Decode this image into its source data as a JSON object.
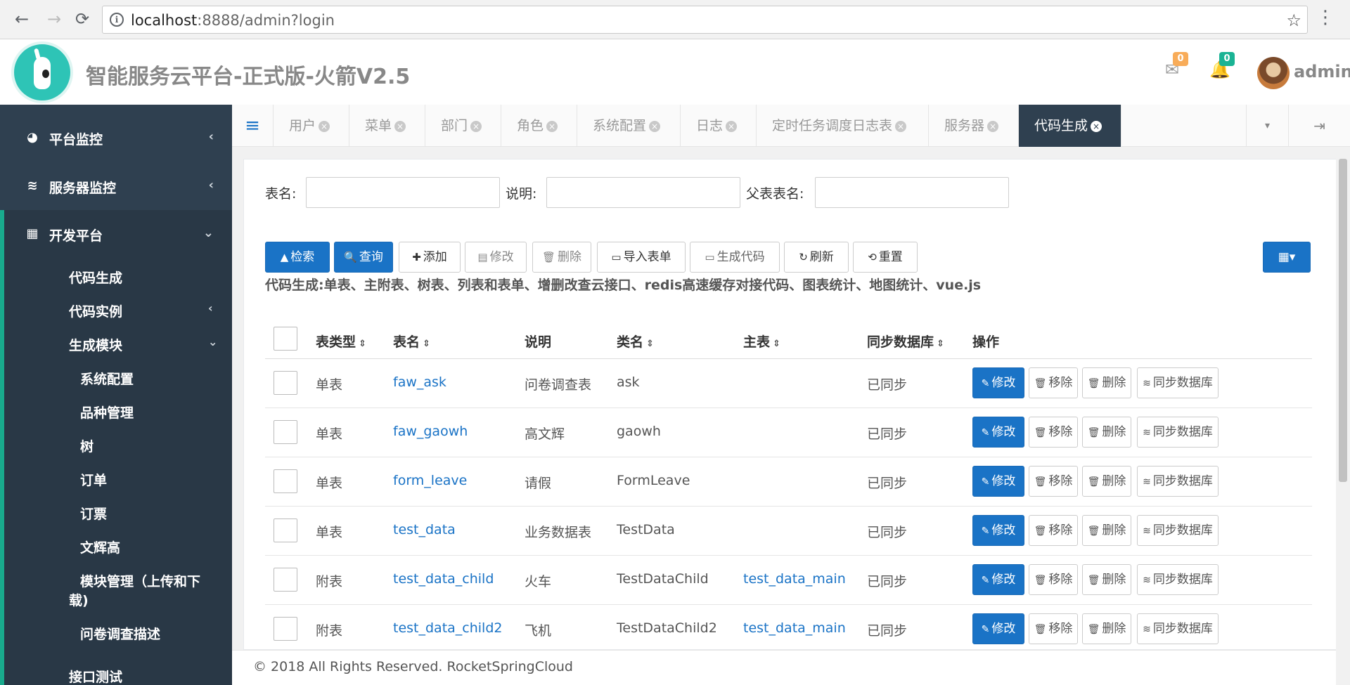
{
  "browser": {
    "url_host": "localhost",
    "url_rest": ":8888/admin?login",
    "back": "←",
    "forward": "→",
    "reload": "⟳",
    "info": "i",
    "star": "☆",
    "menu": "⋮"
  },
  "header": {
    "title": "智能服务云平台-正式版-火箭V2.5",
    "mail_count": "0",
    "bell_count": "0",
    "user": "admin",
    "mail_badge_color": "#f8ac59",
    "bell_badge_color": "#1ab394"
  },
  "sidebar": {
    "items": [
      {
        "label": "平台监控",
        "icon": "dashboard-icon",
        "glyph": "◕",
        "chev": "‹"
      },
      {
        "label": "服务器监控",
        "icon": "database-icon",
        "glyph": "≋",
        "chev": "‹"
      },
      {
        "label": "开发平台",
        "icon": "grid-icon",
        "glyph": "▦",
        "chev": "⌄"
      }
    ],
    "sub_items": [
      {
        "label": "代码生成"
      },
      {
        "label": "代码实例",
        "chev": "‹"
      },
      {
        "label": "生成模块",
        "chev": "⌄"
      }
    ],
    "module_items": [
      "系统配置",
      "品种管理",
      "树",
      "订单",
      "订票",
      "文辉高",
      "模块管理（上传和下",
      "载)",
      "问卷调查描述"
    ],
    "after_items": [
      "接口测试"
    ],
    "accent": "#19aa8d"
  },
  "tabs": {
    "toggle": "≡",
    "items": [
      "用户",
      "菜单",
      "部门",
      "角色",
      "系统配置",
      "日志",
      "定时任务调度日志表",
      "服务器",
      "代码生成"
    ],
    "active": "代码生成",
    "close": "×",
    "drop": "▾",
    "exit": "⇥"
  },
  "search": {
    "table_name_label": "表名:",
    "desc_label": "说明:",
    "parent_label": "父表表名:",
    "table_name_value": "",
    "desc_value": "",
    "parent_value": ""
  },
  "toolbar": {
    "retrieve": "检索",
    "retrieve_icon": "▲",
    "query": "查询",
    "query_icon": "🔍",
    "add": "添加",
    "add_icon": "✚",
    "edit": "修改",
    "edit_icon": "▤",
    "delete": "删除",
    "delete_icon": "🗑",
    "import": "导入表单",
    "import_icon": "▭",
    "generate": "生成代码",
    "generate_icon": "▭",
    "refresh": "刷新",
    "refresh_icon": "↻",
    "reset": "重置",
    "reset_icon": "⟲",
    "columns_icon": "▦▾",
    "description": "代码生成:单表、主附表、树表、列表和表单、增删改查云接口、redis高速缓存对接代码、图表统计、地图统计、vue.js"
  },
  "table": {
    "columns": [
      "表类型",
      "表名",
      "说明",
      "类名",
      "主表",
      "同步数据库",
      "操作"
    ],
    "sort_glyph": "⇕",
    "rows": [
      {
        "type": "单表",
        "name": "faw_ask",
        "desc": "问卷调查表",
        "class": "ask",
        "main": "",
        "sync": "已同步"
      },
      {
        "type": "单表",
        "name": "faw_gaowh",
        "desc": "高文辉",
        "class": "gaowh",
        "main": "",
        "sync": "已同步"
      },
      {
        "type": "单表",
        "name": "form_leave",
        "desc": "请假",
        "class": "FormLeave",
        "main": "",
        "sync": "已同步"
      },
      {
        "type": "单表",
        "name": "test_data",
        "desc": "业务数据表",
        "class": "TestData",
        "main": "",
        "sync": "已同步"
      },
      {
        "type": "附表",
        "name": "test_data_child",
        "desc": "火车",
        "class": "TestDataChild",
        "main": "test_data_main",
        "sync": "已同步"
      },
      {
        "type": "附表",
        "name": "test_data_child2",
        "desc": "飞机",
        "class": "TestDataChild2",
        "main": "test_data_main",
        "sync": "已同步"
      }
    ],
    "row_actions": {
      "edit": "修改",
      "edit_icon": "✎",
      "remove": "移除",
      "remove_icon": "🗑",
      "delete": "删除",
      "delete_icon": "🗑",
      "sync": "同步数据库",
      "sync_icon": "≋"
    }
  },
  "footer": {
    "text": "© 2018 All Rights Reserved. RocketSpringCloud"
  }
}
